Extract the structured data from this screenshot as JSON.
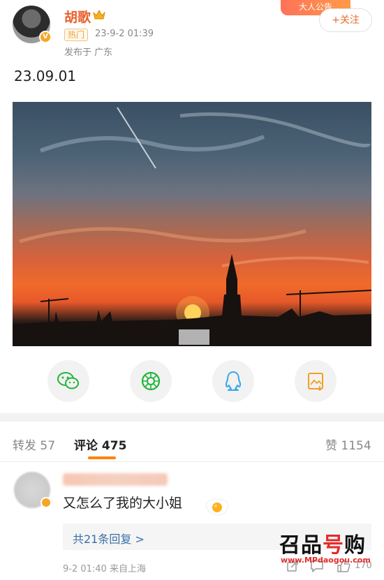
{
  "header": {
    "corner_banner": "大人公告",
    "username": "胡歌",
    "hot_badge": "热门",
    "post_time": "23-9-2 01:39",
    "location": "发布于 广东",
    "follow_label": "+关注"
  },
  "post": {
    "text": "23.09.01"
  },
  "share": {
    "icons": [
      "wechat-icon",
      "moments-icon",
      "qq-icon",
      "save-image-icon"
    ],
    "accent": "#f2f2f2"
  },
  "tabs": {
    "repost_label": "转发",
    "repost_count": "57",
    "comments_label": "评论",
    "comments_count": "475",
    "likes_label": "赞",
    "likes_count": "1154",
    "indicator_color": "#ff8200"
  },
  "comment": {
    "text": "又怎么了我的大小姐",
    "reply_link": "共21条回复 >",
    "meta": "9-2 01:40  来自上海",
    "like_count": "170"
  },
  "watermark": {
    "title_a": "召品",
    "title_b": "号",
    "title_c": "购",
    "url": "www.MPdaogou.com"
  }
}
